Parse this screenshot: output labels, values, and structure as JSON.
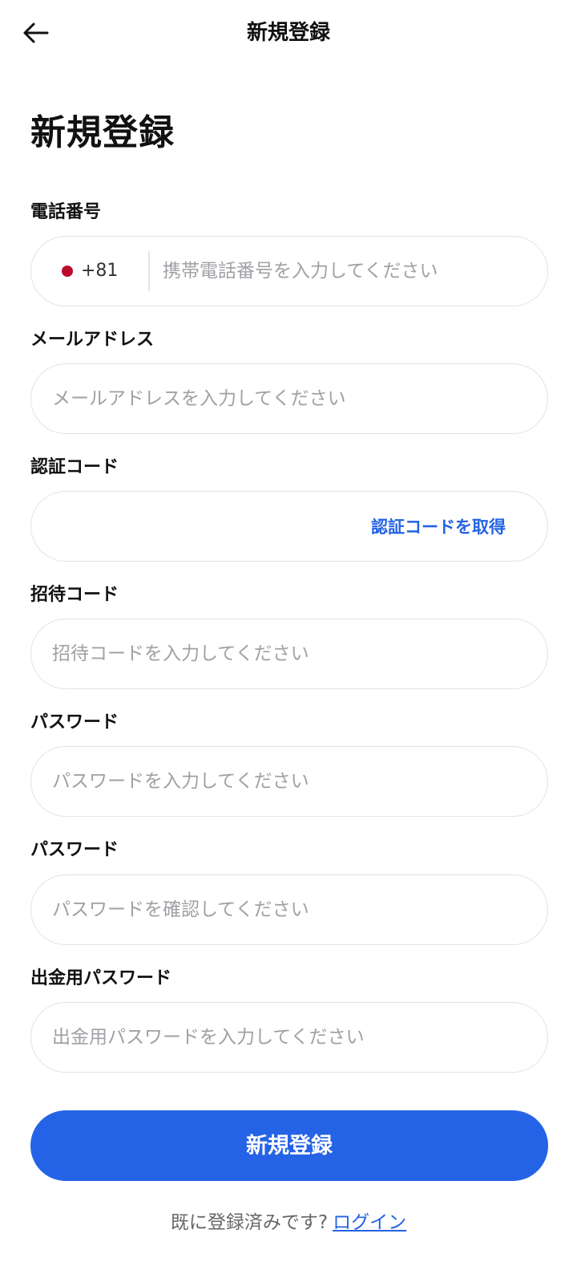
{
  "header": {
    "title": "新規登録",
    "back_icon": "arrow-left-icon"
  },
  "page_title": "新規登録",
  "form": {
    "phone": {
      "label": "電話番号",
      "dial_code": "+81",
      "flag_color": "#bc0c2c",
      "placeholder": "携帯電話番号を入力してください",
      "value": ""
    },
    "email": {
      "label": "メールアドレス",
      "placeholder": "メールアドレスを入力してください",
      "value": ""
    },
    "verification_code": {
      "label": "認証コード",
      "placeholder": "",
      "value": "",
      "action_label": "認証コードを取得"
    },
    "invite_code": {
      "label": "招待コード",
      "placeholder": "招待コードを入力してください",
      "value": ""
    },
    "password": {
      "label": "パスワード",
      "placeholder": "パスワードを入力してください",
      "value": ""
    },
    "password_confirm": {
      "label": "パスワード",
      "placeholder": "パスワードを確認してください",
      "value": ""
    },
    "withdraw_password": {
      "label": "出金用パスワード",
      "placeholder": "出金用パスワードを入力してください",
      "value": ""
    }
  },
  "submit_label": "新規登録",
  "footer": {
    "prompt": "既に登録済みです?",
    "login_link": "ログイン"
  },
  "colors": {
    "accent": "#2563e6",
    "link": "#2463e4",
    "border": "#e3e3e6",
    "placeholder": "#a0a0a6"
  }
}
